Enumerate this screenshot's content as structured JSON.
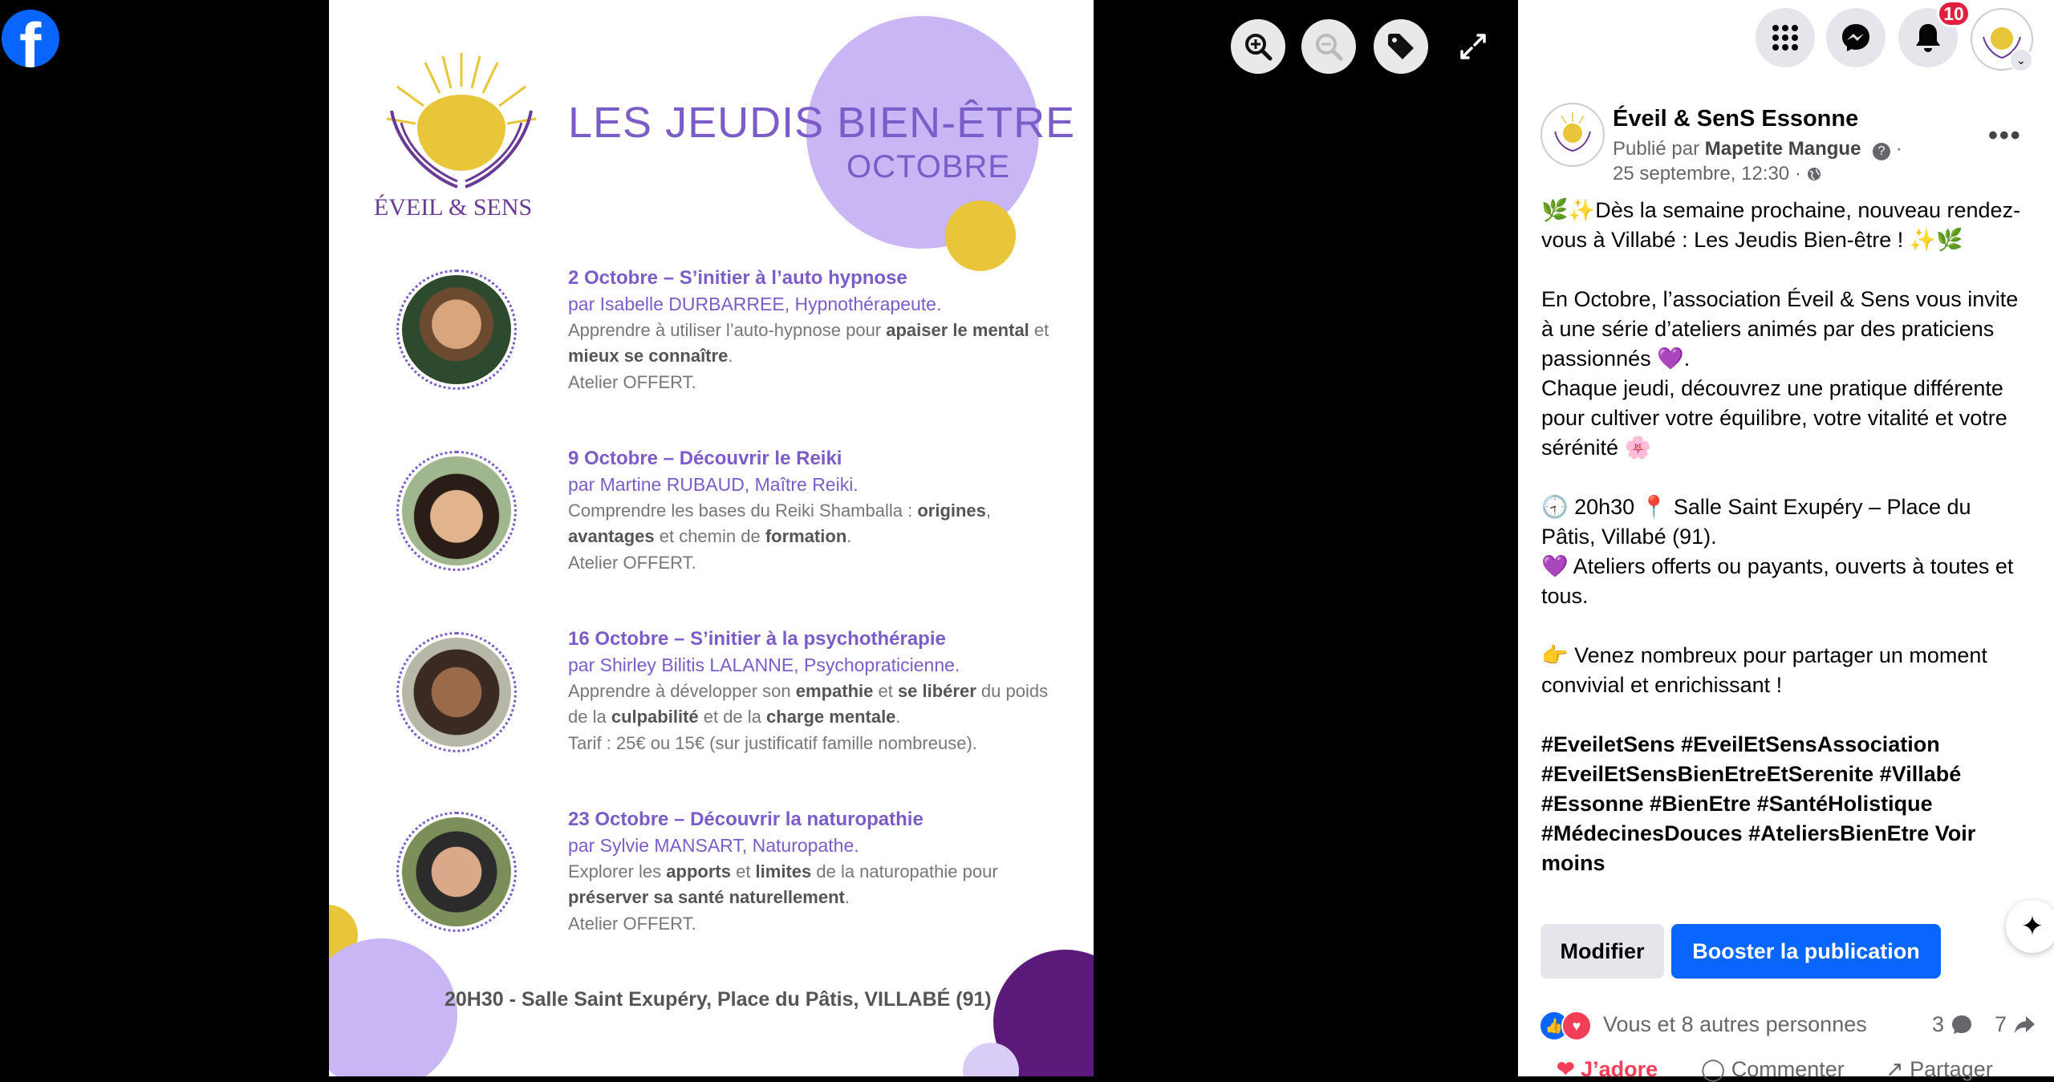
{
  "viewer": {
    "zoom_in_icon": "zoom-in-icon",
    "zoom_out_icon": "zoom-out-icon",
    "tag_icon": "tag-icon",
    "fullscreen_icon": "expand-icon"
  },
  "poster": {
    "brand": "ÉVEIL & SENS",
    "title_left": "LES JEUDIS",
    "title_right": "BIEN-ÊTRE",
    "subtitle": "OCTOBRE",
    "sessions": [
      {
        "title": "2 Octobre – S’initier à l’auto hypnose",
        "by": "par Isabelle DURBARREE, Hypnothérapeute.",
        "desc_html": "Apprendre à utiliser l’auto-hypnose pour <b>apaiser le mental</b> et <b>mieux se connaître</b>.",
        "note": "Atelier OFFERT."
      },
      {
        "title": "9 Octobre – Découvrir le Reiki",
        "by": "par Martine RUBAUD, Maître Reiki.",
        "desc_html": "Comprendre les bases du Reiki Shamballa : <b>origines</b>, <b>avantages</b> et chemin de <b>formation</b>.",
        "note": "Atelier OFFERT."
      },
      {
        "title": "16 Octobre – S’initier à la psychothérapie",
        "by": "par Shirley Bilitis LALANNE, Psychopraticienne.",
        "desc_html": "Apprendre à développer son <b>empathie</b> et <b>se libérer</b> du poids de la <b>culpabilité</b> et de la <b>charge mentale</b>.",
        "note": "Tarif : 25€ ou 15€ (sur justificatif famille nombreuse)."
      },
      {
        "title": "23 Octobre – Découvrir la naturopathie",
        "by": "par Sylvie MANSART, Naturopathe.",
        "desc_html": "Explorer les <b>apports</b> et <b>limites</b> de la naturopathie pour <b>préserver sa santé naturellement</b>.",
        "note": "Atelier OFFERT."
      }
    ],
    "footer": "20H30 - Salle Saint Exupéry, Place du Pâtis, VILLABÉ (91)"
  },
  "topbar": {
    "notification_count": "10",
    "menu_icon": "grid-menu-icon",
    "messenger_icon": "messenger-icon",
    "bell_icon": "bell-icon"
  },
  "post": {
    "page_name": "Éveil & SenS Essonne",
    "published_by_prefix": "Publié par",
    "published_by": "Mapetite Mangue",
    "date": "25 septembre, 12:30 ·",
    "paragraphs": [
      "🌿✨Dès la semaine prochaine, nouveau rendez-vous à Villabé : Les Jeudis Bien-être ! ✨🌿",
      "En Octobre, l’association Éveil & Sens vous invite à une série d’ateliers animés par des praticiens passionnés 💜.\nChaque jeudi, découvrez une pratique différente pour cultiver votre équilibre, votre vitalité et votre sérénité 🌸",
      "🕣 20h30 📍 Salle Saint Exupéry – Place du Pâtis, Villabé (91).\n💜 Ateliers offerts ou payants, ouverts à toutes et tous.",
      "👉 Venez nombreux pour partager un moment convivial et enrichissant !"
    ],
    "hashtags": "#EveiletSens #EveilEtSensAssociation #EveilEtSensBienEtreEtSerenite #Villabé #Essonne #BienEtre #SantéHolistique #MédecinesDouces #AteliersBienEtre",
    "see_less": "Voir moins",
    "edit_label": "Modifier",
    "boost_label": "Booster la publication",
    "reactions_text": "Vous et 8 autres personnes",
    "comments_count": "3",
    "shares_count": "7",
    "action_love": "J’adore",
    "action_comment": "Commenter",
    "action_share": "Partager"
  },
  "colors": {
    "facebook_blue": "#0866ff",
    "poster_purple": "#7b5cc8",
    "lavender": "#c9b6f5",
    "sun_yellow": "#e9c53a",
    "dark_purple": "#5b1a7a"
  }
}
